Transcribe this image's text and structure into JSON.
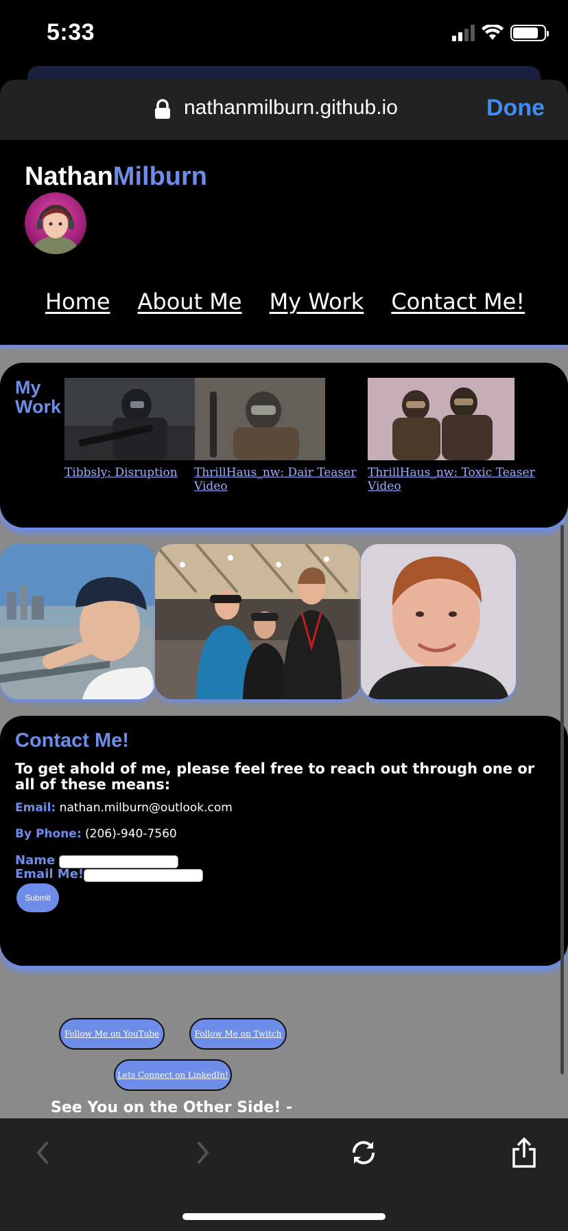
{
  "status_bar": {
    "time": "5:33"
  },
  "url_bar": {
    "url": "nathanmilburn.github.io",
    "done_label": "Done"
  },
  "header": {
    "brand_first": "Nathan",
    "brand_last": "Milburn",
    "nav": [
      "Home",
      "About Me",
      "My Work",
      "Contact Me!"
    ]
  },
  "work": {
    "title": "My Work",
    "items": [
      {
        "caption": "Tibbsly: Disruption"
      },
      {
        "caption": "ThrillHaus_nw: Dair Teaser Video"
      },
      {
        "caption": "ThrillHaus_nw: Toxic Teaser Video"
      }
    ]
  },
  "contact": {
    "title": "Contact Me!",
    "intro": "To get ahold of me, please feel free to reach out through one or all of these means:",
    "email_label": "Email:",
    "email_value": "nathan.milburn@outlook.com",
    "phone_label": "By Phone:",
    "phone_value": "(206)-940-7560",
    "name_label": "Name",
    "email_me_label": "Email Me!",
    "submit_label": "Submit"
  },
  "social": {
    "youtube": "Follow Me on YouTube",
    "twitch": "Follow Me on Twitch",
    "linkedin": "Lets Connect on LinkedIn!"
  },
  "footer": {
    "text": "See You on the Other Side! -"
  },
  "colors": {
    "accent": "#6d8de8",
    "link_blue": "#3d8df5",
    "page_bg": "#8a8a8a"
  }
}
